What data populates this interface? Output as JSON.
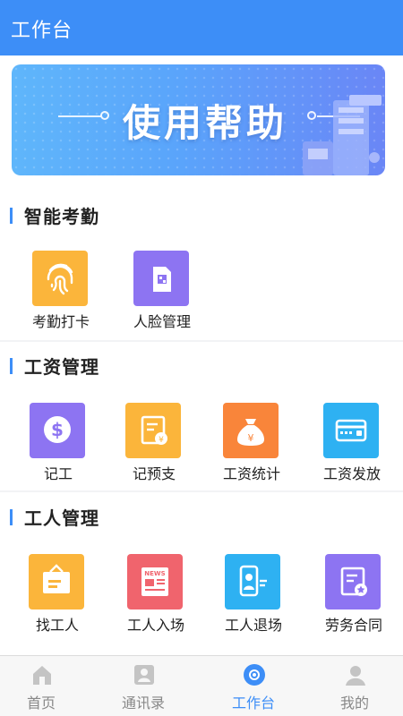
{
  "header": {
    "title": "工作台"
  },
  "banner": {
    "title": "使用帮助"
  },
  "sections": [
    {
      "title": "智能考勤",
      "items": [
        {
          "label": "考勤打卡",
          "icon": "fingerprint-icon",
          "color": "#fbb53b"
        },
        {
          "label": "人脸管理",
          "icon": "face-card-icon",
          "color": "#8d74f2"
        }
      ]
    },
    {
      "title": "工资管理",
      "items": [
        {
          "label": "记工",
          "icon": "dollar-icon",
          "color": "#8d74f2"
        },
        {
          "label": "记预支",
          "icon": "advance-icon",
          "color": "#fbb53b"
        },
        {
          "label": "工资统计",
          "icon": "money-bag-icon",
          "color": "#f9853a"
        },
        {
          "label": "工资发放",
          "icon": "card-icon",
          "color": "#2eb1f2"
        }
      ]
    },
    {
      "title": "工人管理",
      "items": [
        {
          "label": "找工人",
          "icon": "signboard-icon",
          "color": "#fbb53b"
        },
        {
          "label": "工人入场",
          "icon": "news-icon",
          "color": "#f0646d"
        },
        {
          "label": "工人退场",
          "icon": "badge-icon",
          "color": "#2eb1f2"
        },
        {
          "label": "劳务合同",
          "icon": "contract-icon",
          "color": "#8d74f2"
        }
      ]
    }
  ],
  "bottom_nav": [
    {
      "label": "首页",
      "icon": "home-icon",
      "active": false
    },
    {
      "label": "通讯录",
      "icon": "contacts-icon",
      "active": false
    },
    {
      "label": "工作台",
      "icon": "workbench-icon",
      "active": true
    },
    {
      "label": "我的",
      "icon": "profile-icon",
      "active": false
    }
  ],
  "colors": {
    "primary": "#3d8ef7",
    "inactive": "#888888"
  }
}
